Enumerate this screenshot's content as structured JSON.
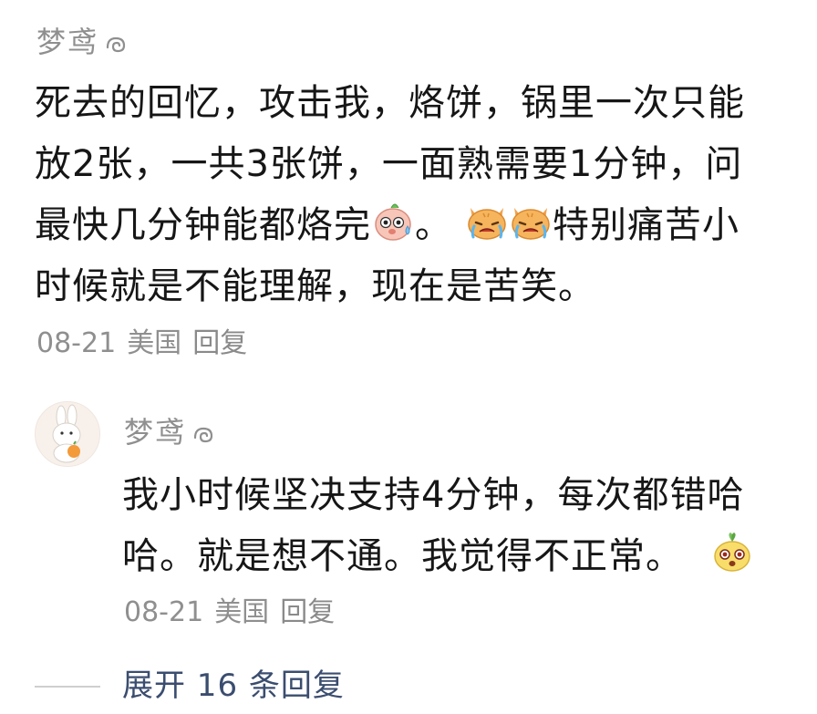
{
  "comments": [
    {
      "username": "梦鸢",
      "level_icon": "level-1-badge-icon",
      "text_lines": [
        "死去的回忆，攻击我，烙饼，锅里一次只能",
        "放2张，一共3张饼，一面熟需要1分钟，问",
        "最快几分钟能都烙完",
        "。",
        "特别痛苦小",
        "时候就是不能理解，现在是苦笑。"
      ],
      "emojis": [
        "sweating-pig-emoji",
        "crying-cat-emoji",
        "crying-cat-emoji"
      ],
      "date": "08-21",
      "location": "美国",
      "reply_label": "回复"
    },
    {
      "username": "梦鸢",
      "level_icon": "level-1-badge-icon",
      "avatar": "bunny-avatar",
      "text_lines": [
        "我小时候坚决支持4分钟，每次都错哈",
        "哈。就是想不通。我觉得不正常。"
      ],
      "emojis": [
        "surprised-sprout-emoji"
      ],
      "date": "08-21",
      "location": "美国",
      "reply_label": "回复"
    }
  ],
  "expand": {
    "label": "展开 16 条回复",
    "color": "#3b4d6f"
  },
  "colors": {
    "username": "#8f8f8f",
    "text": "#161616",
    "meta": "#8f8f8f"
  }
}
